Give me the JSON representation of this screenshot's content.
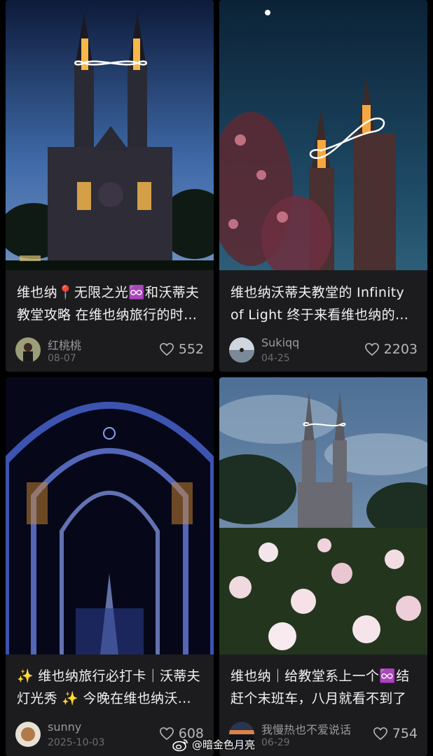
{
  "feed": {
    "cards": [
      {
        "title": "维也纳📍无限之光♾️和沃蒂夫教堂攻略 在维也纳旅行的时候...",
        "author": "红桃桃",
        "date": "08-07",
        "likes": "552"
      },
      {
        "title": "维也纳沃蒂夫教堂的 Infinity of Light 终于来看维也纳的无限之光",
        "author": "Sukiqq",
        "date": "04-25",
        "likes": "2203"
      },
      {
        "title": "✨ 维也纳旅行必打卡｜沃蒂夫灯光秀 ✨ 今晚在维也纳沃蒂夫教堂",
        "author": "sunny",
        "date": "2025-10-03",
        "likes": "608"
      },
      {
        "title": "维也纳｜给教堂系上一个♾️结 赶个末班车，八月就看不到了",
        "author": "我慢热也不爱说话",
        "date": "06-29",
        "likes": "754"
      }
    ]
  },
  "watermark": {
    "text": "@暗金色月亮",
    "icon": "weibo-icon"
  },
  "colors": {
    "background": "#000000",
    "card": "#1c1c1e",
    "title": "#f2f2f2",
    "meta": "#9a9a9e"
  }
}
